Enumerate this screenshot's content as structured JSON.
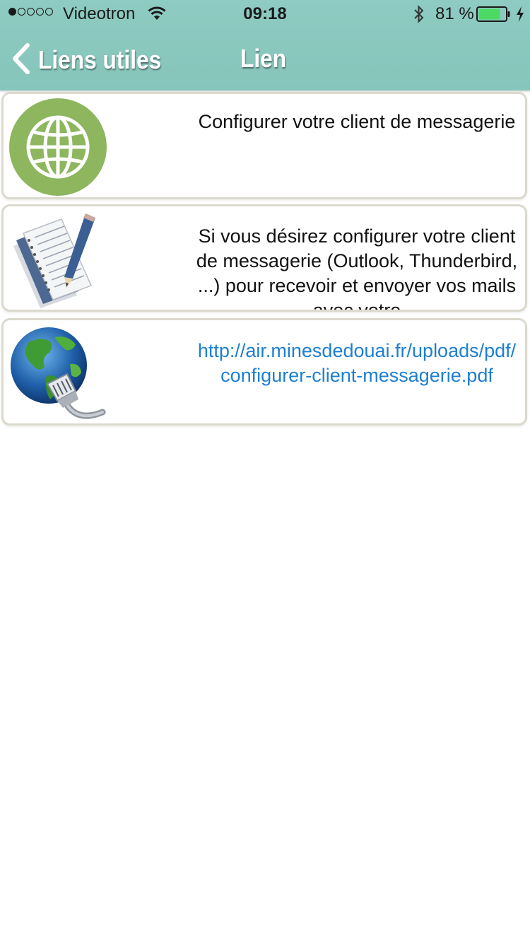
{
  "status_bar": {
    "carrier": "Videotron",
    "time": "09:18",
    "battery_percent": "81 %",
    "battery_level": 0.81,
    "signal_bars_filled": 1,
    "signal_bars_total": 5,
    "icons": [
      "wifi-icon",
      "bluetooth-icon",
      "battery-icon",
      "charging-icon"
    ]
  },
  "nav": {
    "back_label": "Liens utiles",
    "title": "Lien"
  },
  "cards": [
    {
      "icon": "globe-icon",
      "text": "Configurer votre client de messagerie"
    },
    {
      "icon": "document-pencil-icon",
      "text": "Si vous désirez configurer votre client de messagerie (Outlook, Thunderbird, ...) pour recevoir et envoyer vos mails avec votre"
    },
    {
      "icon": "network-globe-icon",
      "text": "http://air.minesdedouai.fr/uploads/pdf/configurer-client-messagerie.pdf"
    }
  ],
  "colors": {
    "header": "#8ecbc2",
    "link": "#1d7fd2",
    "card_border": "#dcd9cd",
    "globe_green": "#8db65e",
    "battery_fill": "#4cd964"
  }
}
